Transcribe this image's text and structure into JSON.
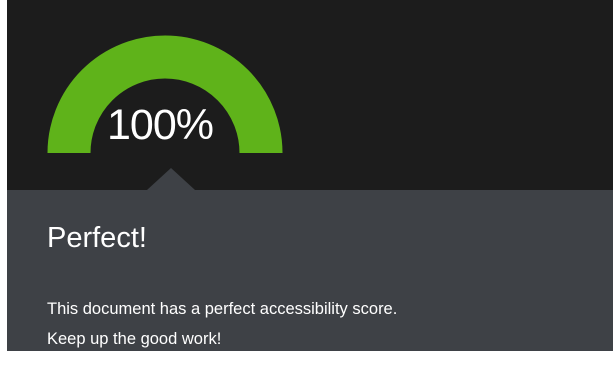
{
  "gauge": {
    "score_percent": 100,
    "score_label": "100%",
    "fill_color": "#5fb31a"
  },
  "panel": {
    "headline": "Perfect!",
    "message_line1": "This document has a perfect accessibility score.",
    "message_line2": "Keep up the good work!"
  }
}
